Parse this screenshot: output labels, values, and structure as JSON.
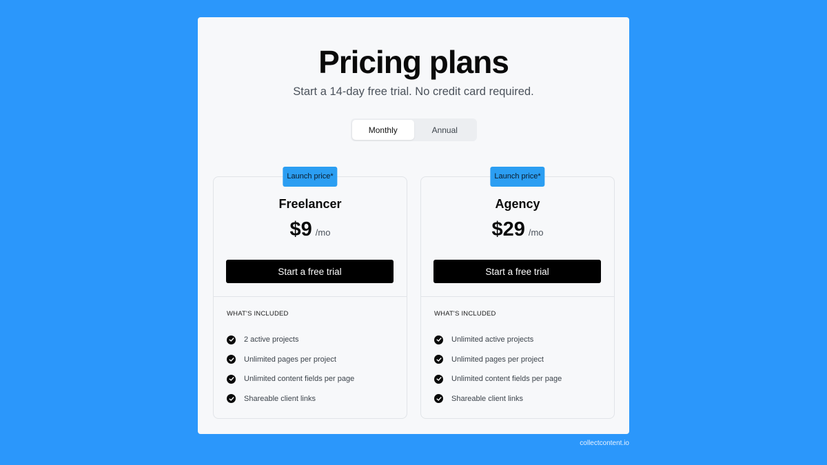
{
  "header": {
    "title": "Pricing plans",
    "subtitle": "Start a 14-day free trial. No credit card required."
  },
  "billing_toggle": {
    "options": [
      "Monthly",
      "Annual"
    ],
    "selected": "Monthly"
  },
  "plans": [
    {
      "badge": "Launch price*",
      "name": "Freelancer",
      "price": "$9",
      "period": "/mo",
      "cta": "Start a free trial",
      "included_heading": "WHAT'S INCLUDED",
      "features": [
        "2 active projects",
        "Unlimited pages per project",
        "Unlimited content fields per page",
        "Shareable client links"
      ]
    },
    {
      "badge": "Launch price*",
      "name": "Agency",
      "price": "$29",
      "period": "/mo",
      "cta": "Start a free trial",
      "included_heading": "WHAT'S INCLUDED",
      "features": [
        "Unlimited active projects",
        "Unlimited pages per project",
        "Unlimited content fields per page",
        "Shareable client links"
      ]
    }
  ],
  "footer": {
    "brand": "collectcontent.io"
  },
  "colors": {
    "background": "#2b97fb",
    "badge": "#2b9ef2",
    "cta": "#000000"
  }
}
